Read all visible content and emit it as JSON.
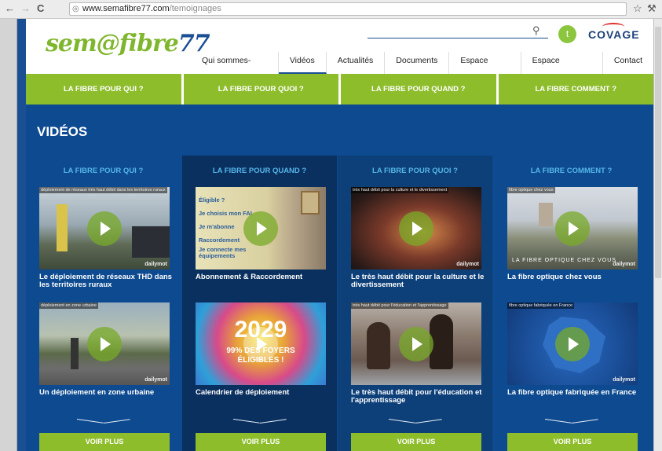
{
  "browser": {
    "url_domain": "www.semafibre77.com",
    "url_path": "/temoignages"
  },
  "site": {
    "logo": {
      "text1": "sem@fibre",
      "text2": "77"
    },
    "partner": "COVAGE",
    "nav": [
      "Qui sommes-nous ?",
      "Vidéos",
      "Actualités",
      "Documents",
      "Espace Presse",
      "Espace Opérateur",
      "Contact"
    ],
    "categories": [
      "LA FIBRE POUR QUI ?",
      "LA FIBRE POUR QUOI ?",
      "LA FIBRE POUR QUAND ?",
      "LA FIBRE COMMENT ?"
    ],
    "heading": "VIDÉOS",
    "columns": [
      {
        "title": "LA FIBRE POUR QUI ?",
        "videos": [
          {
            "tag": "déploiement de réseaux très haut débit dans les territoires ruraux",
            "caption": "Le déploiement de réseaux THD dans les territoires ruraux"
          },
          {
            "tag": "déploiement en zone urbaine",
            "caption": "Un déploiement en zone urbaine"
          }
        ]
      },
      {
        "title": "LA FIBRE POUR QUAND ?",
        "videos": [
          {
            "tag": "",
            "caption": "Abonnement & Raccordement",
            "overlay": [
              "Éligible ?",
              "Je choisis mon FAI",
              "Je m'abonne",
              "Raccordement",
              "Je connecte mes équipements"
            ]
          },
          {
            "tag": "",
            "caption": "Calendrier de déploiement",
            "overlay": [
              "2029",
              "99% DES FOYERS ÉLIGIBLES !"
            ]
          }
        ]
      },
      {
        "title": "LA FIBRE POUR QUOI ?",
        "videos": [
          {
            "tag": "très haut débit pour la culture et le divertissement",
            "caption": "Le très haut débit pour la culture et le divertissement"
          },
          {
            "tag": "très haut débit pour l'éducation et l'apprentissage",
            "caption": "Le très haut débit pour l'éducation et l'apprentissage"
          }
        ]
      },
      {
        "title": "LA FIBRE COMMENT ?",
        "videos": [
          {
            "tag": "fibre optique chez vous",
            "caption": "La fibre optique chez vous",
            "overlay": [
              "LA FIBRE OPTIQUE CHEZ VOUS"
            ]
          },
          {
            "tag": "fibre optique fabriquée en France",
            "caption": "La fibre optique fabriquée en France"
          }
        ]
      }
    ],
    "more_label": "VOIR PLUS",
    "dailymotion": "dailymot",
    "colors": {
      "brand_green": "#8ebd2c",
      "brand_blue": "#0d4a90",
      "col_dark": "#0a3060",
      "col_mid": "#0d3f79",
      "link_blue": "#55b6e8"
    }
  }
}
